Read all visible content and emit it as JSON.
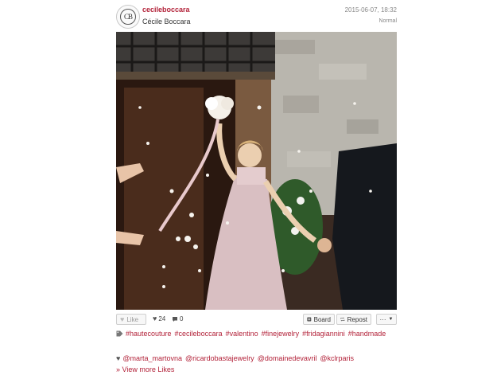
{
  "post": {
    "username": "cecileboccara",
    "fullname": "Cécile Boccara",
    "timestamp": "2015-06-07, 18:32",
    "filter": "Normal",
    "avatar_text": "CB"
  },
  "actions": {
    "like_label": "Like",
    "likes_count": "24",
    "comments_count": "0",
    "board_label": "Board",
    "repost_label": "Repost",
    "more_label": "···",
    "icons": {
      "like": "heart-icon",
      "likes": "heart-icon",
      "comments": "speech-bubble-icon",
      "board": "plus-box-icon",
      "repost": "repost-arrows-icon",
      "more": "caret-down-icon"
    }
  },
  "hashtags": [
    "#hautecouture",
    "#cecileboccara",
    "#valentino",
    "#finejewelry",
    "#fridagiannini",
    "#handmade"
  ],
  "likers": [
    "@marta_martovna",
    "@ricardobastajewelry",
    "@domainedevavril",
    "@kclrparis"
  ],
  "view_more": "» View more Likes",
  "colors": {
    "accent": "#b3233a",
    "muted": "#888888"
  }
}
